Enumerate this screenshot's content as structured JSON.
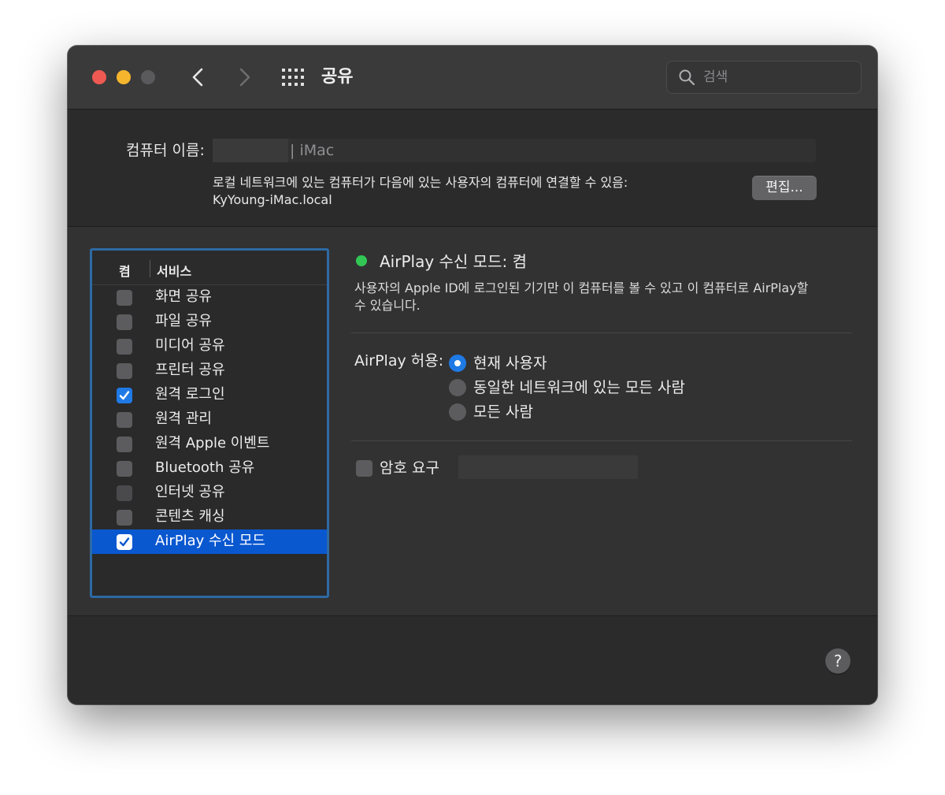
{
  "window": {
    "title": "공유"
  },
  "search": {
    "placeholder": "검색"
  },
  "computer_name": {
    "label": "컴퓨터 이름:",
    "value_suffix": "| iMac",
    "description_line1": "로컬 네트워크에 있는 컴퓨터가 다음에 있는 사용자의 컴퓨터에 연결할 수 있음:",
    "description_line2": "KyYoung-iMac.local",
    "edit_label": "편집..."
  },
  "services": {
    "header_on": "켬",
    "header_service": "서비스",
    "items": [
      {
        "label": "화면 공유",
        "checked": false,
        "selected": false
      },
      {
        "label": "파일 공유",
        "checked": false,
        "selected": false
      },
      {
        "label": "미디어 공유",
        "checked": false,
        "selected": false
      },
      {
        "label": "프린터 공유",
        "checked": false,
        "selected": false
      },
      {
        "label": "원격 로그인",
        "checked": true,
        "selected": false
      },
      {
        "label": "원격 관리",
        "checked": false,
        "selected": false
      },
      {
        "label": "원격 Apple 이벤트",
        "checked": false,
        "selected": false
      },
      {
        "label": "Bluetooth 공유",
        "checked": false,
        "selected": false
      },
      {
        "label": "인터넷 공유",
        "checked": false,
        "selected": false
      },
      {
        "label": "콘텐츠 캐싱",
        "checked": false,
        "selected": false
      },
      {
        "label": "AirPlay 수신 모드",
        "checked": true,
        "selected": true
      }
    ]
  },
  "detail": {
    "status_title": "AirPlay 수신 모드: 켬",
    "status_color": "#32c754",
    "status_desc_line1": "사용자의 Apple ID에 로그인된 기기만 이 컴퓨터를 볼 수 있고 이 컴퓨터로 AirPlay할",
    "status_desc_line2": "수 있습니다.",
    "allow_label": "AirPlay 허용:",
    "options": [
      {
        "label": "현재 사용자",
        "selected": true
      },
      {
        "label": "동일한 네트워크에 있는 모든 사람",
        "selected": false
      },
      {
        "label": "모든 사람",
        "selected": false
      }
    ],
    "password_label": "암호 요구",
    "password_checked": false
  },
  "help": {
    "label": "?"
  },
  "colors": {
    "accent": "#1f7ae6",
    "selection": "#0a58d0",
    "focus_ring": "#2d6aa3"
  }
}
